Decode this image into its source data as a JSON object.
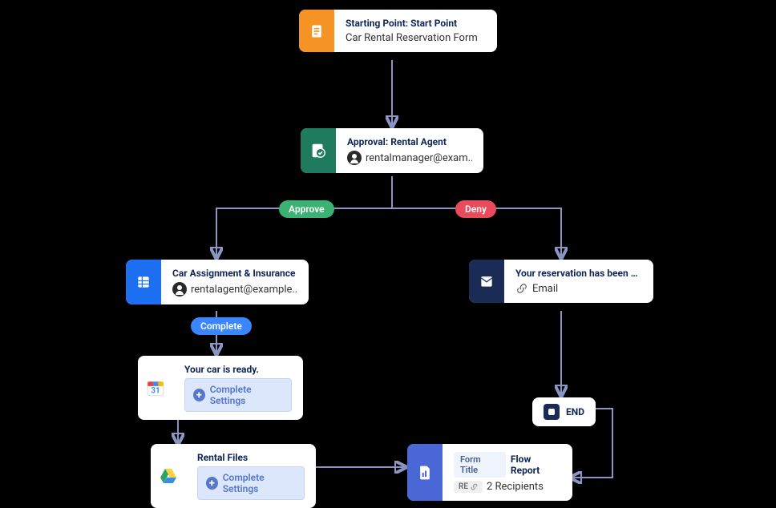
{
  "nodes": {
    "start": {
      "title": "Starting Point: Start Point",
      "sub": "Car Rental Reservation Form"
    },
    "approval": {
      "title": "Approval: Rental Agent",
      "sub": "rentalmanager@exam..."
    },
    "car_assign": {
      "title": "Car Assignment & Insurance",
      "sub": "rentalagent@example...."
    },
    "denied": {
      "title": "Your reservation has been de...",
      "sub": "Email"
    },
    "ready": {
      "title": "Your car is ready.",
      "btn": "Complete Settings"
    },
    "files": {
      "title": "Rental Files",
      "btn": "Complete Settings"
    },
    "report": {
      "tag": "Form Title",
      "tag2": "Flow Report",
      "pill": "RE",
      "sub": "2 Recipients"
    }
  },
  "badges": {
    "approve": "Approve",
    "deny": "Deny",
    "complete": "Complete"
  },
  "end": "END"
}
